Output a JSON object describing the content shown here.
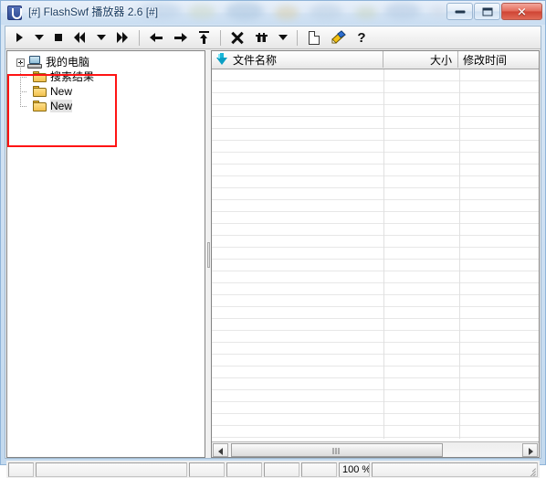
{
  "window": {
    "title": "[#] FlashSwf 播放器 2.6 [#]",
    "app_icon": "flash-player-icon",
    "controls": {
      "minimize": "minimize-icon",
      "maximize": "maximize-icon",
      "close": "✕"
    }
  },
  "toolbar": {
    "items": [
      {
        "name": "play-button",
        "icon": "play-icon"
      },
      {
        "name": "play-dropdown-button",
        "icon": "chevron-down-icon"
      },
      {
        "name": "stop-button",
        "icon": "stop-icon"
      },
      {
        "name": "rewind-button",
        "icon": "rewind-icon"
      },
      {
        "name": "rewind-dropdown-button",
        "icon": "chevron-down-icon"
      },
      {
        "name": "fast-forward-button",
        "icon": "fast-forward-icon"
      },
      {
        "name": "back-button",
        "icon": "arrow-left-icon"
      },
      {
        "name": "forward-button",
        "icon": "arrow-right-icon"
      },
      {
        "name": "up-level-button",
        "icon": "arrow-up-icon"
      },
      {
        "name": "delete-button",
        "icon": "close-x-icon"
      },
      {
        "name": "find-button",
        "icon": "binoculars-icon"
      },
      {
        "name": "find-dropdown-button",
        "icon": "chevron-down-icon"
      },
      {
        "name": "new-button",
        "icon": "new-document-icon"
      },
      {
        "name": "options-button",
        "icon": "flag-tool-icon"
      },
      {
        "name": "help-button",
        "icon": "question-mark-icon",
        "label": "?"
      }
    ]
  },
  "tree": {
    "nodes": [
      {
        "label": "我的电脑",
        "icon": "computer-icon",
        "expander": "plus-box",
        "selected": false
      },
      {
        "label": "搜索结果",
        "icon": "folder-icon",
        "expander": "none",
        "selected": false
      },
      {
        "label": "New",
        "icon": "folder-icon",
        "expander": "none",
        "selected": false
      },
      {
        "label": "New",
        "icon": "folder-icon",
        "expander": "none",
        "selected": true
      }
    ]
  },
  "annotation": {
    "highlight_rect_color": "#ff1414"
  },
  "filelist": {
    "columns": [
      {
        "key": "name",
        "label": "文件名称",
        "sort_icon": "sort-descending-icon",
        "align": "left"
      },
      {
        "key": "size",
        "label": "大小",
        "align": "right"
      },
      {
        "key": "time",
        "label": "修改时间",
        "align": "left"
      }
    ],
    "rows": [],
    "scrollbar": {
      "left_arrow": "scroll-left-icon",
      "right_arrow": "scroll-right-icon",
      "thumb_grip": "grip-icon"
    }
  },
  "statusbar": {
    "panes": [
      "",
      "",
      "",
      "",
      "",
      "",
      "100 %",
      ""
    ],
    "zoom_value": "100 %",
    "resize_grip": "resize-grip-icon"
  }
}
